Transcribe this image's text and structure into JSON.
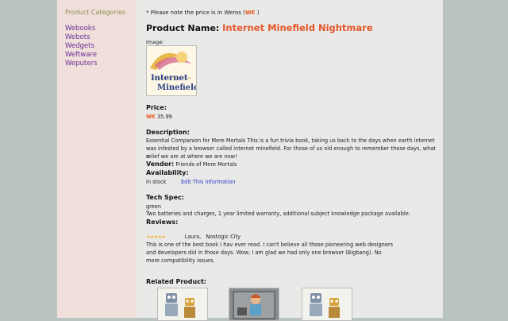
{
  "sidebar": {
    "title": "Product Categories",
    "items": [
      {
        "label": "Webooks"
      },
      {
        "label": "Webots"
      },
      {
        "label": "Wedgets"
      },
      {
        "label": "Weftware"
      },
      {
        "label": "Weputers"
      }
    ]
  },
  "note": {
    "prefix": "* Please note the price is in Weros (",
    "currency": "W€",
    "suffix": " )"
  },
  "product": {
    "name_label": "Product Name:",
    "name": "Internet Minefield Nightmare",
    "image_label": "Image:",
    "image_text_line1": "Internet",
    "image_text_line2": "Minefield",
    "price_label": "Price:",
    "currency": "W€",
    "price": "35.99",
    "description_label": "Description:",
    "description_line1": "Essential Companion for Mere Mortals This is a fun trivia book, taking us back to the days when earth internet",
    "description_line2": "was infested by a browser called internet minefield. For those of us old enough to remember those days, what a",
    "description_line3": "relief we are at where we are now!",
    "vendor_label": "Vendor:",
    "vendor": "Friends of Mere Mortals",
    "availability_label": "Availability:",
    "availability": "in stock",
    "edit_link": "Edit This Information",
    "techspec_label": "Tech Spec:",
    "techspec_line1": "green",
    "techspec_line2": "Two batteries and charges, 1 year limited warranty, additional subject knowledge package available.",
    "reviews_label": "Reviews:",
    "review": {
      "stars": "★★★★★",
      "rating": 5,
      "author": "Laura,",
      "location": "Nostogic City",
      "line1": "This is one of the best book I hav ever read. I can't believe all those pioneering web designers",
      "line2": "and developers did in those days. Wow, I am glad we had only one browser (Bigbang). No",
      "line3": "more compatibility issues."
    },
    "related_label": "Related Product:"
  },
  "colors": {
    "accent": "#e3572a",
    "link": "#6a2f98",
    "edit_link": "#2a3cc8",
    "stars": "#f2b531"
  }
}
